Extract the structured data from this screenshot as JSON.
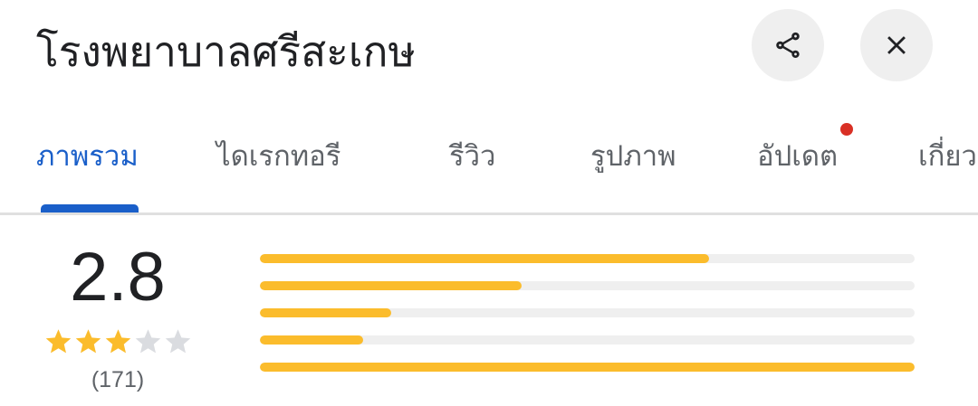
{
  "header": {
    "title": "โรงพยาบาลศรีสะเกษ",
    "share_icon": "share-icon",
    "close_icon": "close-icon"
  },
  "tabs": [
    {
      "label": "ภาพรวม",
      "active": true
    },
    {
      "label": "ไดเรกทอรี",
      "active": false
    },
    {
      "label": "รีวิว",
      "active": false
    },
    {
      "label": "รูปภาพ",
      "active": false
    },
    {
      "label": "อัปเดต",
      "active": false,
      "badge_dot": true
    },
    {
      "label": "เกี่ยว",
      "active": false
    }
  ],
  "rating": {
    "score": "2.8",
    "stars_filled": 3,
    "stars_total": 5,
    "review_count": "(171)"
  },
  "distribution": {
    "fractions": [
      0.686,
      0.4,
      0.2,
      0.158,
      1.0
    ]
  },
  "colors": {
    "accent": "#1a5fc9",
    "star": "#fbbc2c",
    "star_empty": "#dadce0",
    "badge": "#d93025",
    "track": "#efefef"
  }
}
